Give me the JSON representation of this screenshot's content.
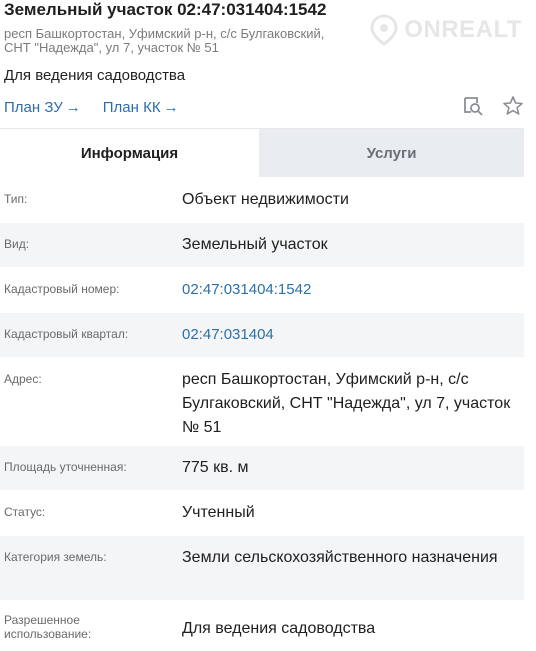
{
  "header": {
    "title": "Земельный участок 02:47:031404:1542",
    "address_short": "респ Башкортостан, Уфимский р-н, с/с Булгаковский, СНТ \"Надежда\", ул 7, участок № 51",
    "purpose": "Для ведения садоводства",
    "links": [
      {
        "label": "План ЗУ",
        "icon": "arrow-right-icon"
      },
      {
        "label": "План КК",
        "icon": "arrow-right-icon"
      }
    ],
    "watermark": "ONREALT"
  },
  "tabs": [
    {
      "label": "Информация",
      "active": true
    },
    {
      "label": "Услуги",
      "active": false
    }
  ],
  "rows": [
    {
      "label": "Тип:",
      "value": "Объект недвижимости"
    },
    {
      "label": "Вид:",
      "value": "Земельный участок"
    },
    {
      "label": "Кадастровый номер:",
      "value": "02:47:031404:1542"
    },
    {
      "label": "Кадастровый квартал:",
      "value": "02:47:031404"
    },
    {
      "label": "Адрес:",
      "value": "респ Башкортостан, Уфимский р-н, с/с Булгаковский, СНТ \"Надежда\", ул 7, участок № 51"
    },
    {
      "label": "Площадь уточненная:",
      "value": "775 кв. м"
    },
    {
      "label": "Статус:",
      "value": "Учтенный"
    },
    {
      "label": "Категория земель:",
      "value": "Земли сельскохозяйственного назначения"
    },
    {
      "label": "Разрешенное использование:",
      "value": "Для ведения садоводства"
    }
  ],
  "colors": {
    "link": "#2c6db5",
    "tab_inactive_bg": "#e9edf2",
    "row_alt_bg": "#f3f5f7"
  }
}
